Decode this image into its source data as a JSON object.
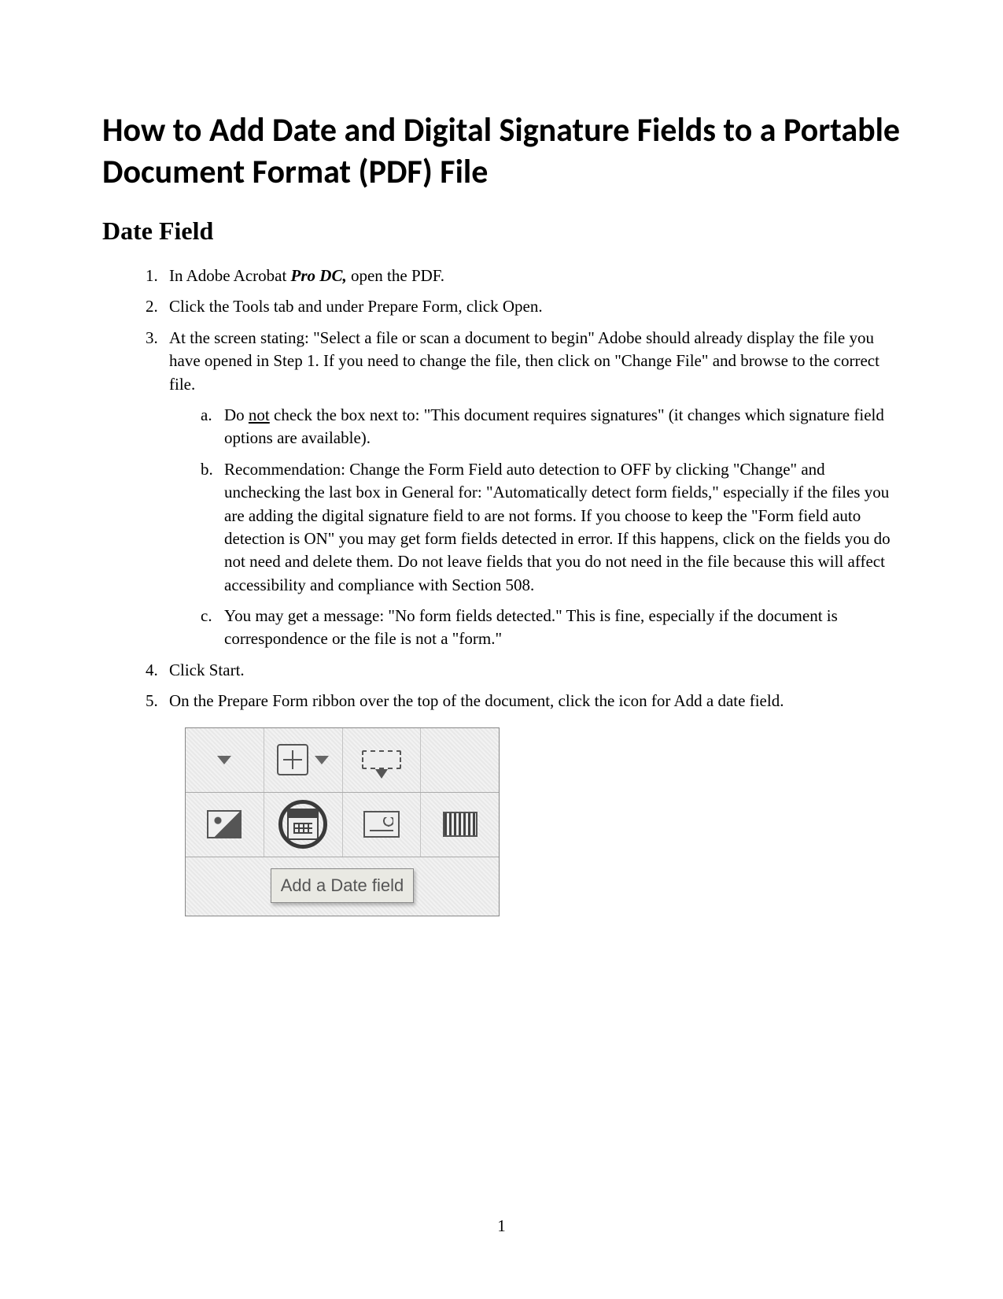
{
  "title": "How to Add Date and Digital Signature Fields to a Portable Document Format (PDF) File",
  "section_heading": "Date Field",
  "steps": {
    "s1_pre": "In Adobe Acrobat ",
    "s1_emph": "Pro DC,",
    "s1_post": " open the PDF.",
    "s2": "Click the Tools tab and under Prepare Form, click Open.",
    "s3": "At the screen stating: \"Select a file or scan a document to begin\" Adobe should already display the file you have opened in Step 1.  If you need to change the file, then click on \"Change File\" and browse to the correct file.",
    "s3a_pre": "Do ",
    "s3a_underline": "not",
    "s3a_post": " check the box next to: \"This document requires signatures\" (it changes which signature field options are available).",
    "s3b": "Recommendation:  Change the Form Field auto detection to OFF by clicking \"Change\" and unchecking the last box in General for: \"Automatically detect form fields,\" especially if the files you are adding the digital signature field to are not forms.  If you choose to keep the \"Form field auto detection is ON\" you may get form fields detected in error.  If this happens, click on the fields you do not need and delete them.  Do not leave fields that you do not need in the file because this will affect accessibility and compliance with Section 508.",
    "s3c": "You may get a message: \"No form fields detected.\"  This is fine, especially if the document is correspondence or the file is not a \"form.\"",
    "s4": "Click Start.",
    "s5": "On the Prepare Form ribbon over the top of the document, click the icon for Add a date field."
  },
  "markers": {
    "m1": "1.",
    "m2": "2.",
    "m3": "3.",
    "m4": "4.",
    "m5": "5.",
    "ma": "a.",
    "mb": "b.",
    "mc": "c."
  },
  "tooltip_label": "Add a Date field",
  "page_number": "1"
}
